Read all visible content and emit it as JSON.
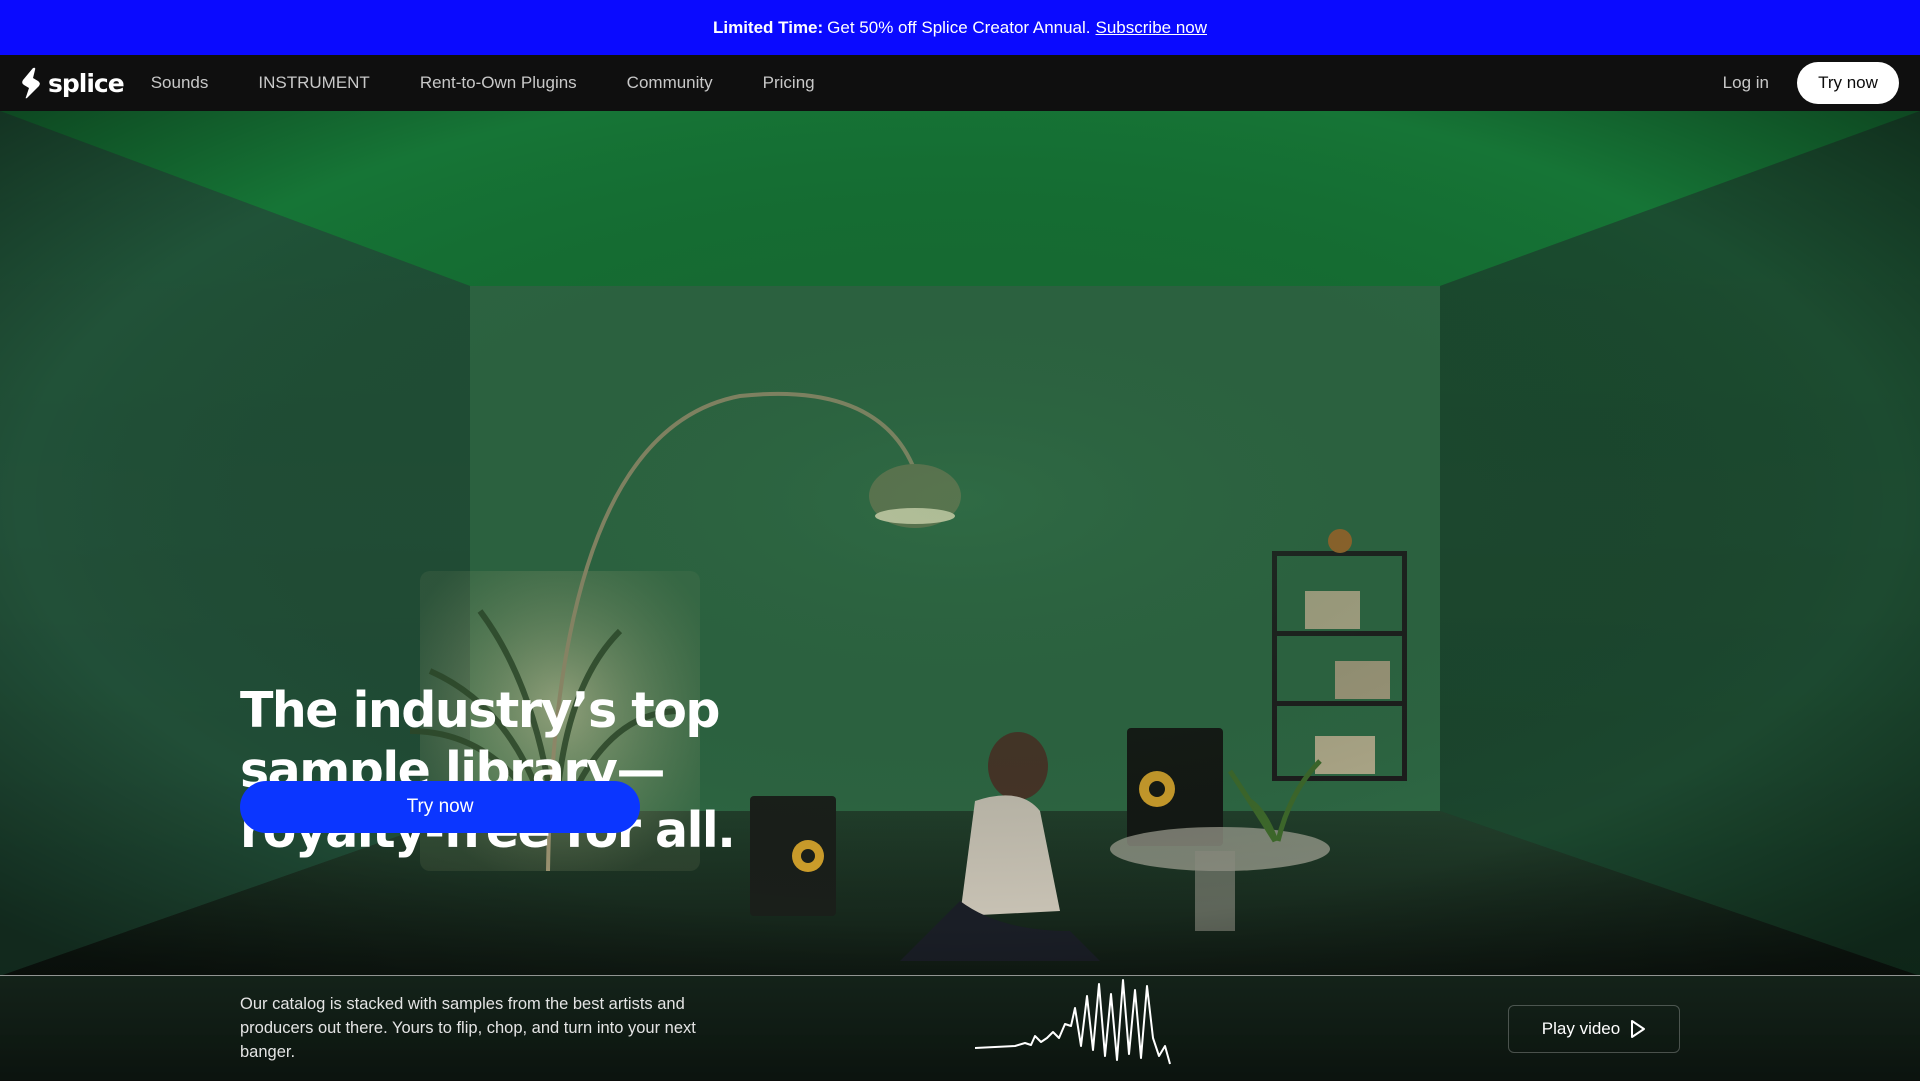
{
  "promo": {
    "highlight": "Limited Time:",
    "text": "Get 50% off Splice Creator Annual.",
    "link": "Subscribe now"
  },
  "nav": {
    "logo_text": "splice",
    "items": [
      {
        "label": "Sounds"
      },
      {
        "label": "INSTRUMENT"
      },
      {
        "label": "Rent-to-Own Plugins"
      },
      {
        "label": "Community"
      },
      {
        "label": "Pricing"
      }
    ],
    "login_label": "Log in",
    "cta_label": "Try now"
  },
  "hero": {
    "headline_lines": [
      "The industry’s top",
      "sample library—",
      "royalty-free for all."
    ],
    "cta_label": "Try now"
  },
  "strip": {
    "description": "Our catalog is stacked with samples from the best artists and producers out there. Yours to flip, chop, and turn into your next banger.",
    "play_label": "Play video"
  },
  "colors": {
    "promo_bg": "#0a0aff",
    "nav_bg": "#0f0f0f",
    "cta_blue": "#0b36ff",
    "hero_green": "#1b5a33"
  },
  "icons": {
    "logo": "splice-logo-icon",
    "play": "play-icon"
  }
}
